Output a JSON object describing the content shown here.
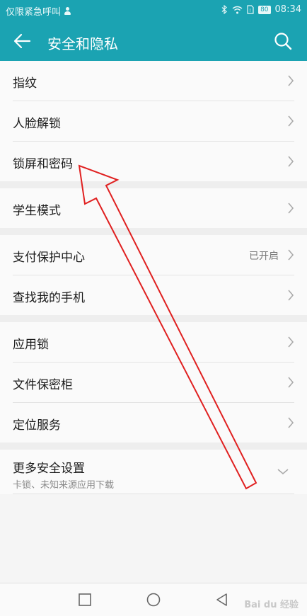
{
  "status_bar": {
    "left_text": "仅限紧急呼叫",
    "battery": "80",
    "time": "08:34"
  },
  "header": {
    "title": "安全和隐私"
  },
  "groups": [
    {
      "items": [
        {
          "label": "指纹"
        },
        {
          "label": "人脸解锁"
        },
        {
          "label": "锁屏和密码"
        }
      ]
    },
    {
      "items": [
        {
          "label": "学生模式"
        }
      ]
    },
    {
      "items": [
        {
          "label": "支付保护中心",
          "value": "已开启"
        },
        {
          "label": "查找我的手机"
        }
      ]
    },
    {
      "items": [
        {
          "label": "应用锁"
        },
        {
          "label": "文件保密柜"
        },
        {
          "label": "定位服务"
        }
      ]
    },
    {
      "items": [
        {
          "label": "更多安全设置",
          "subtitle": "卡锁、未知来源应用下载"
        }
      ]
    }
  ],
  "annotation": {
    "arrow_color": "#e02020"
  },
  "watermark": "Bai du 经验",
  "colors": {
    "accent": "#1ba3b2",
    "background": "#f5f5f5"
  }
}
